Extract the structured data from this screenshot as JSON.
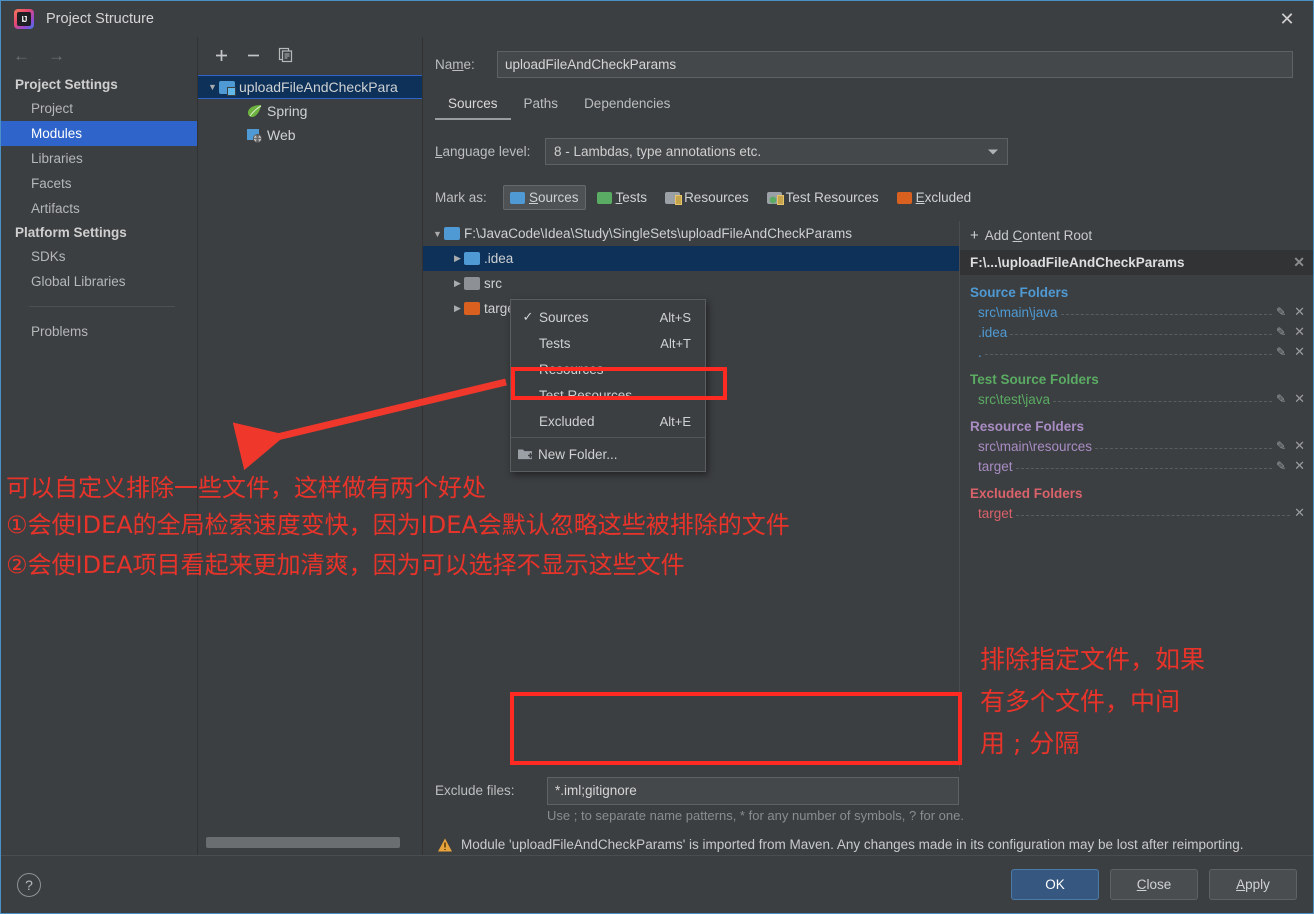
{
  "window": {
    "title": "Project Structure",
    "app_icon": "intellij-idea-icon",
    "close_icon": "✕"
  },
  "sidebar": {
    "back_icon": "←",
    "forward_icon": "→",
    "groups": [
      {
        "label": "Project Settings",
        "items": [
          {
            "label": "Project",
            "selected": false
          },
          {
            "label": "Modules",
            "selected": true
          },
          {
            "label": "Libraries",
            "selected": false
          },
          {
            "label": "Facets",
            "selected": false
          },
          {
            "label": "Artifacts",
            "selected": false
          }
        ]
      },
      {
        "label": "Platform Settings",
        "items": [
          {
            "label": "SDKs",
            "selected": false
          },
          {
            "label": "Global Libraries",
            "selected": false
          }
        ]
      }
    ],
    "problems": "Problems"
  },
  "modules_panel": {
    "toolbar": {
      "add": "+",
      "remove": "−",
      "copy": "copy-icon"
    },
    "tree": [
      {
        "label": "uploadFileAndCheckPara",
        "icon": "module-folder-icon",
        "expanded": true,
        "selected": true,
        "depth": 0
      },
      {
        "label": "Spring",
        "icon": "spring-leaf-icon",
        "depth": 1
      },
      {
        "label": "Web",
        "icon": "web-facet-icon",
        "depth": 1
      }
    ]
  },
  "main": {
    "name_label": "Name:",
    "name_value": "uploadFileAndCheckParams",
    "tabs": [
      {
        "label": "Sources",
        "active": true
      },
      {
        "label": "Paths",
        "active": false
      },
      {
        "label": "Dependencies",
        "active": false
      }
    ],
    "language_level_label": "Language level:",
    "language_level_value": "8 - Lambdas, type annotations etc.",
    "mark_as_label": "Mark as:",
    "mark_as_buttons": [
      {
        "label": "Sources",
        "color": "#4f9ad4",
        "pressed": true
      },
      {
        "label": "Tests",
        "color": "#5aab63",
        "pressed": false
      },
      {
        "label": "Resources",
        "color": "#8d9094",
        "pressed": false
      },
      {
        "label": "Test Resources",
        "color": "#8d9094",
        "pressed": false
      },
      {
        "label": "Excluded",
        "color": "#d9601f",
        "pressed": false
      }
    ],
    "roots_tree": [
      {
        "label": "F:\\JavaCode\\Idea\\Study\\SingleSets\\uploadFileAndCheckParams",
        "expanded": true,
        "selected": false,
        "indent": false,
        "color": "#4f9ad4"
      },
      {
        "label": ".idea",
        "expanded": false,
        "selected": true,
        "indent": true,
        "color": "#4f9ad4"
      },
      {
        "label": "src",
        "expanded": false,
        "selected": false,
        "indent": true,
        "color": "#8d9094"
      },
      {
        "label": "target",
        "expanded": false,
        "selected": false,
        "indent": true,
        "color": "#d9601f"
      }
    ],
    "exclude_files_label": "Exclude files:",
    "exclude_files_value": "*.iml;gitignore",
    "exclude_files_hint": "Use ; to separate name patterns, * for any number of symbols, ? for one.",
    "warning_icon": "warning-triangle-icon",
    "warning_text": "Module 'uploadFileAndCheckParams' is imported from Maven. Any changes made in its configuration may be lost after reimporting."
  },
  "content_roots": {
    "add_content_root": "Add Content Root",
    "add_icon": "+",
    "root_header": "F:\\...\\uploadFileAndCheckParams",
    "root_close_icon": "✕",
    "groups": [
      {
        "title": "Source Folders",
        "kind": "src",
        "folders": [
          {
            "path": "src\\main\\java",
            "editable": true
          },
          {
            "path": ".idea",
            "editable": true
          },
          {
            "path": ".",
            "editable": true
          }
        ]
      },
      {
        "title": "Test Source Folders",
        "kind": "test",
        "folders": [
          {
            "path": "src\\test\\java",
            "editable": true
          }
        ]
      },
      {
        "title": "Resource Folders",
        "kind": "res",
        "folders": [
          {
            "path": "src\\main\\resources",
            "editable": true
          },
          {
            "path": "target",
            "editable": true
          }
        ]
      },
      {
        "title": "Excluded Folders",
        "kind": "exc",
        "folders": [
          {
            "path": "target",
            "editable": false
          }
        ]
      }
    ]
  },
  "context_menu": {
    "items": [
      {
        "label": "Sources",
        "accel": "Alt+S",
        "checked": true
      },
      {
        "label": "Tests",
        "accel": "Alt+T",
        "checked": false
      },
      {
        "label": "Resources",
        "accel": "",
        "checked": false
      },
      {
        "label": "Test Resources",
        "accel": "",
        "checked": false
      },
      {
        "label": "Excluded",
        "accel": "Alt+E",
        "checked": false,
        "highlighted": true
      },
      {
        "label": "New Folder...",
        "accel": "",
        "icon": "new-folder-icon"
      }
    ]
  },
  "footer": {
    "help_icon": "?",
    "ok": "OK",
    "close": "Close",
    "apply": "Apply"
  },
  "annotations": {
    "color": "#e8332a",
    "left_lines": [
      "可以自定义排除一些文件，这样做有两个好处",
      "①会使IDEA的全局检索速度变快，因为IDEA会默认忽略这些被排除的文件",
      "②会使IDEA项目看起来更加清爽，因为可以选择不显示这些文件"
    ],
    "right_lines": [
      "排除指定文件，如果",
      "有多个文件，中间",
      "用 ; 分隔"
    ]
  }
}
